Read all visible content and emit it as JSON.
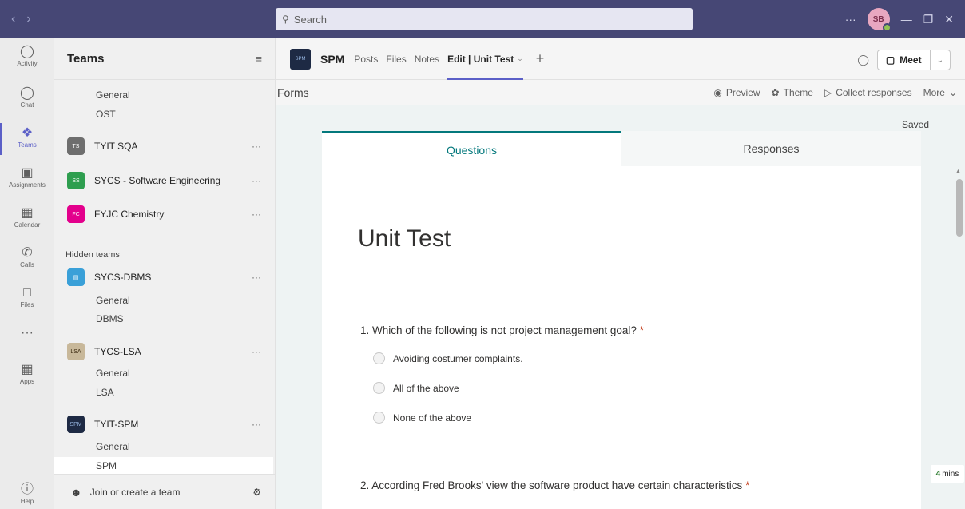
{
  "titlebar": {
    "back_icon": "chevron-left-icon",
    "forward_icon": "chevron-right-icon",
    "search_placeholder": "Search",
    "more": "···",
    "avatar_initials": "SB",
    "minimize": "—",
    "restore": "❐",
    "close": "✕"
  },
  "rail": [
    {
      "label": "Activity",
      "icon": "bell-icon",
      "glyph": "🔔"
    },
    {
      "label": "Chat",
      "icon": "chat-icon",
      "glyph": "💬"
    },
    {
      "label": "Teams",
      "icon": "teams-icon",
      "glyph": "👥"
    },
    {
      "label": "Assignments",
      "icon": "assignments-icon",
      "glyph": "🎒"
    },
    {
      "label": "Calendar",
      "icon": "calendar-icon",
      "glyph": "📅"
    },
    {
      "label": "Calls",
      "icon": "phone-icon",
      "glyph": "📞"
    },
    {
      "label": "Files",
      "icon": "file-icon",
      "glyph": "📄"
    },
    {
      "label": "",
      "icon": "more-icon",
      "glyph": "···"
    },
    {
      "label": "Apps",
      "icon": "apps-icon",
      "glyph": "▦"
    },
    {
      "label": "Help",
      "icon": "help-icon",
      "glyph": "?"
    }
  ],
  "teams_panel": {
    "title": "Teams",
    "filter_icon": "≡",
    "channels_top": [
      "General",
      "OST"
    ],
    "teams": [
      {
        "name": "TYIT SQA",
        "badge": "TS",
        "color": "#6e6e6e",
        "more": "···"
      },
      {
        "name": "SYCS - Software Engineering",
        "badge": "SS",
        "color": "#2e9e4f",
        "more": "···"
      },
      {
        "name": "FYJC Chemistry",
        "badge": "FC",
        "color": "#e3008c",
        "more": "···"
      }
    ],
    "hidden_label": "Hidden teams",
    "hidden": [
      {
        "name": "SYCS-DBMS",
        "badge": "▤",
        "color": "#3aa0d8",
        "more": "···",
        "channels": [
          "General",
          "DBMS"
        ]
      },
      {
        "name": "TYCS-LSA",
        "badge": "LSA",
        "color": "#c8b89a",
        "more": "···",
        "channels": [
          "General",
          "LSA"
        ]
      },
      {
        "name": "TYIT-SPM",
        "badge": "SPM",
        "color": "#1e2a44",
        "more": "···",
        "channels": [
          "General",
          "SPM"
        ]
      }
    ],
    "footer_label": "Join or create a team"
  },
  "channel": {
    "name": "SPM",
    "logo_text": "SPM",
    "tabs": [
      "Posts",
      "Files",
      "Notes",
      "Edit | Unit Test"
    ],
    "active_tab_index": 3,
    "meet_label": "Meet"
  },
  "forms_bar": {
    "label": "Forms",
    "preview": "Preview",
    "theme": "Theme",
    "collect": "Collect responses",
    "more": "More"
  },
  "form": {
    "saved": "Saved",
    "tab_questions": "Questions",
    "tab_responses": "Responses",
    "title": "Unit Test",
    "q1": "1. Which of the following is not project management goal?",
    "q1_options": [
      "Avoiding costumer complaints.",
      "All of the above",
      "None of the above"
    ],
    "q2": "2. According Fred Brooks' view the software product have certain characteristics",
    "required_mark": "*",
    "timer_value": "4",
    "timer_unit": "mins"
  }
}
